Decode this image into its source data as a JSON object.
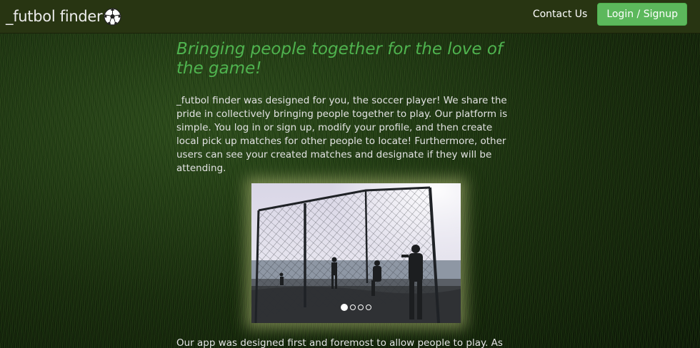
{
  "navbar": {
    "brand_text": "_futbol finder",
    "brand_icon": "soccer-ball-icon",
    "contact_label": "Contact Us",
    "login_label": "Login / Signup",
    "login_color": "#5cb85c"
  },
  "main": {
    "headline": "Bringing people together for the love of the game!",
    "intro": "_futbol finder was designed for you, the soccer player! We share the pride in collectively bringing people together to play. Our platform is simple. You log in or sign up, modify your profile, and then create local pick up matches for other people to locate! Furthermore, other users can see your created matches and designate if they will be attending.",
    "carousel": {
      "slide_count": 4,
      "active_index": 0
    },
    "second_paragraph": "Our app was designed first and foremost to allow people to play. As we"
  },
  "colors": {
    "accent": "#4fb34f",
    "navbar_bg": "#283512"
  }
}
